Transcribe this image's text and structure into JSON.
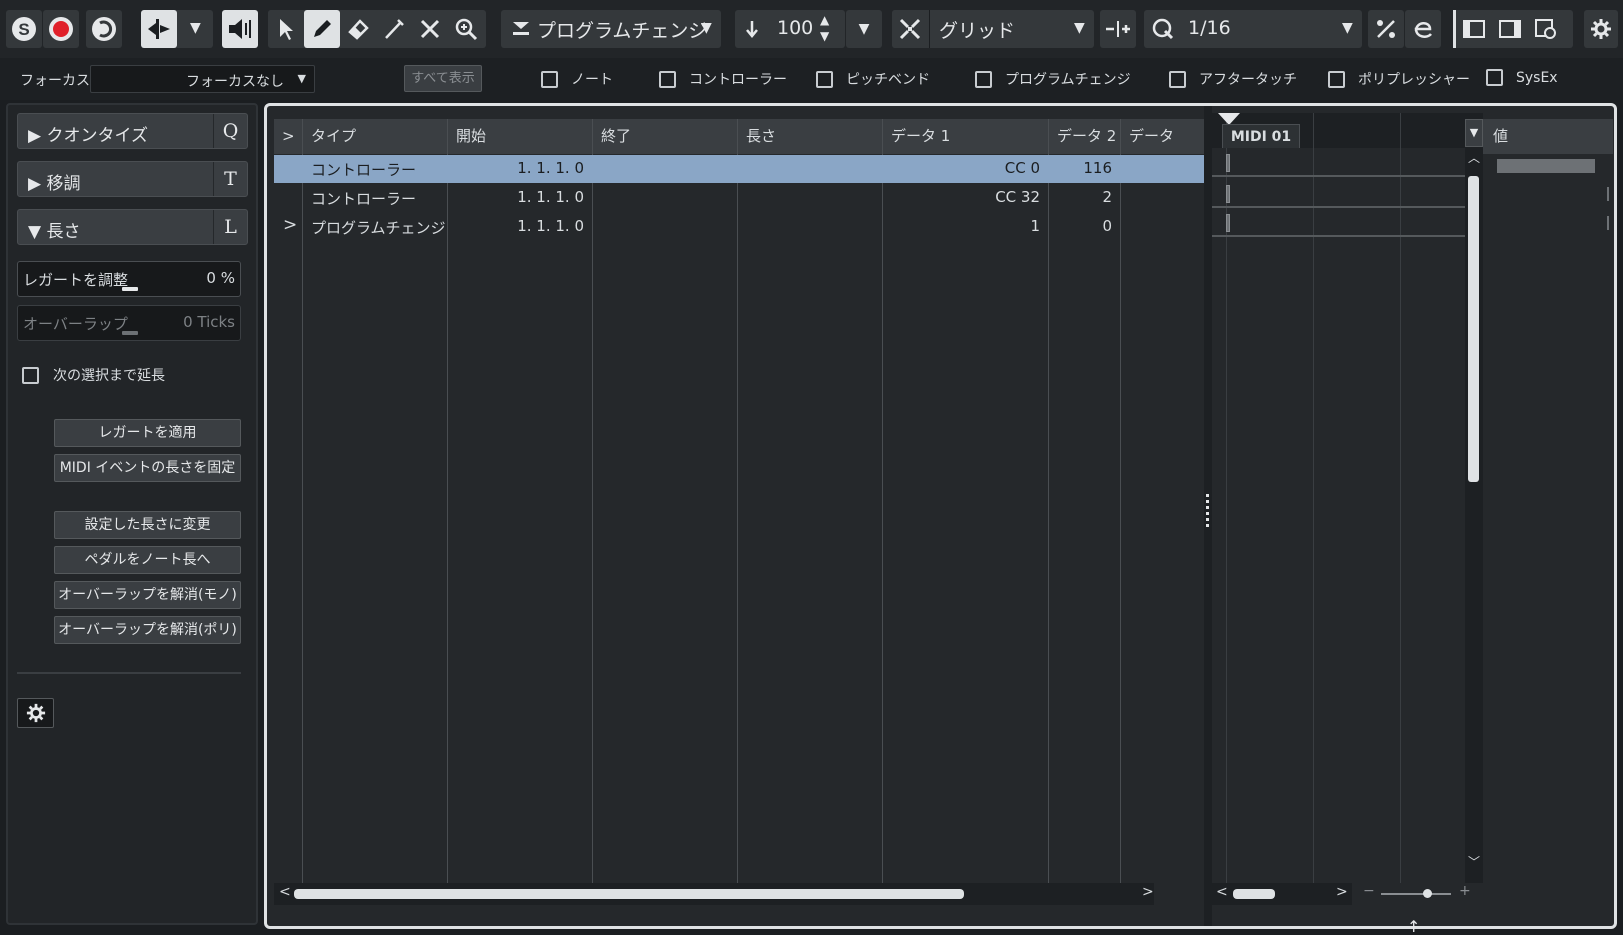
{
  "colors": {
    "accent_selected_row": "#8aa6c6",
    "record_red": "#e0202a",
    "panel": "#222528",
    "button": "#3a3e42"
  },
  "toolbar": {
    "event_type_select": "プログラムチェンジ",
    "insert_velocity": "100",
    "snap_type_select": "グリッド",
    "quantize_value": "1/16",
    "icons": [
      "solo-icon",
      "record-icon",
      "acoustic-feedback-icon",
      "auto-scroll-icon",
      "speaker-icon",
      "pointer-icon",
      "pencil-icon",
      "eraser-icon",
      "line-icon",
      "mute-icon",
      "zoom-icon",
      "snap-icon",
      "insert-velocity-icon",
      "quantize-icon",
      "iterative-quantize-icon",
      "settings-icon"
    ]
  },
  "filterbar": {
    "focus_label": "フォーカス",
    "focus_value": "フォーカスなし",
    "show_all_label": "すべて表示",
    "filters": [
      {
        "label": "ノート",
        "checked": false
      },
      {
        "label": "コントローラー",
        "checked": false
      },
      {
        "label": "ピッチベンド",
        "checked": false
      },
      {
        "label": "プログラムチェンジ",
        "checked": false
      },
      {
        "label": "アフタータッチ",
        "checked": false
      },
      {
        "label": "ポリプレッシャー",
        "checked": false
      },
      {
        "label": "SysEx",
        "checked": false
      }
    ]
  },
  "inspector": {
    "sections": [
      {
        "label": "▶ クオンタイズ",
        "key": "Q"
      },
      {
        "label": "▶ 移調",
        "key": "T"
      },
      {
        "label": "▼ 長さ",
        "key": "L"
      }
    ],
    "legato_label": "レガートを調整",
    "legato_value": "0 %",
    "overlap_label": "オーバーラップ",
    "overlap_value": "0 Ticks",
    "extend_label": "次の選択まで延長",
    "buttons": [
      "レガートを適用",
      "MIDI イベントの長さを固定",
      "設定した長さに変更",
      "ペダルをノート長へ",
      "オーバーラップを解消(モノ)",
      "オーバーラップを解消(ポリ)"
    ]
  },
  "list": {
    "expand_header": ">",
    "columns": [
      "タイプ",
      "開始",
      "終了",
      "長さ",
      "データ 1",
      "データ 2",
      "データ"
    ],
    "rows": [
      {
        "marker": "",
        "type": "コントローラー",
        "start": "1.  1.  1.    0",
        "end": "",
        "length": "",
        "data1": "CC 0",
        "data2": "116",
        "selected": true
      },
      {
        "marker": "",
        "type": "コントローラー",
        "start": "1.  1.  1.    0",
        "end": "",
        "length": "",
        "data1": "CC 32",
        "data2": "2",
        "selected": false
      },
      {
        "marker": ">",
        "type": "プログラムチェンジ",
        "start": "1.  1.  1.    0",
        "end": "",
        "length": "",
        "data1": "1",
        "data2": "0",
        "selected": false
      }
    ]
  },
  "overview": {
    "part_name": "MIDI 01"
  },
  "value_column": {
    "header": "値"
  }
}
